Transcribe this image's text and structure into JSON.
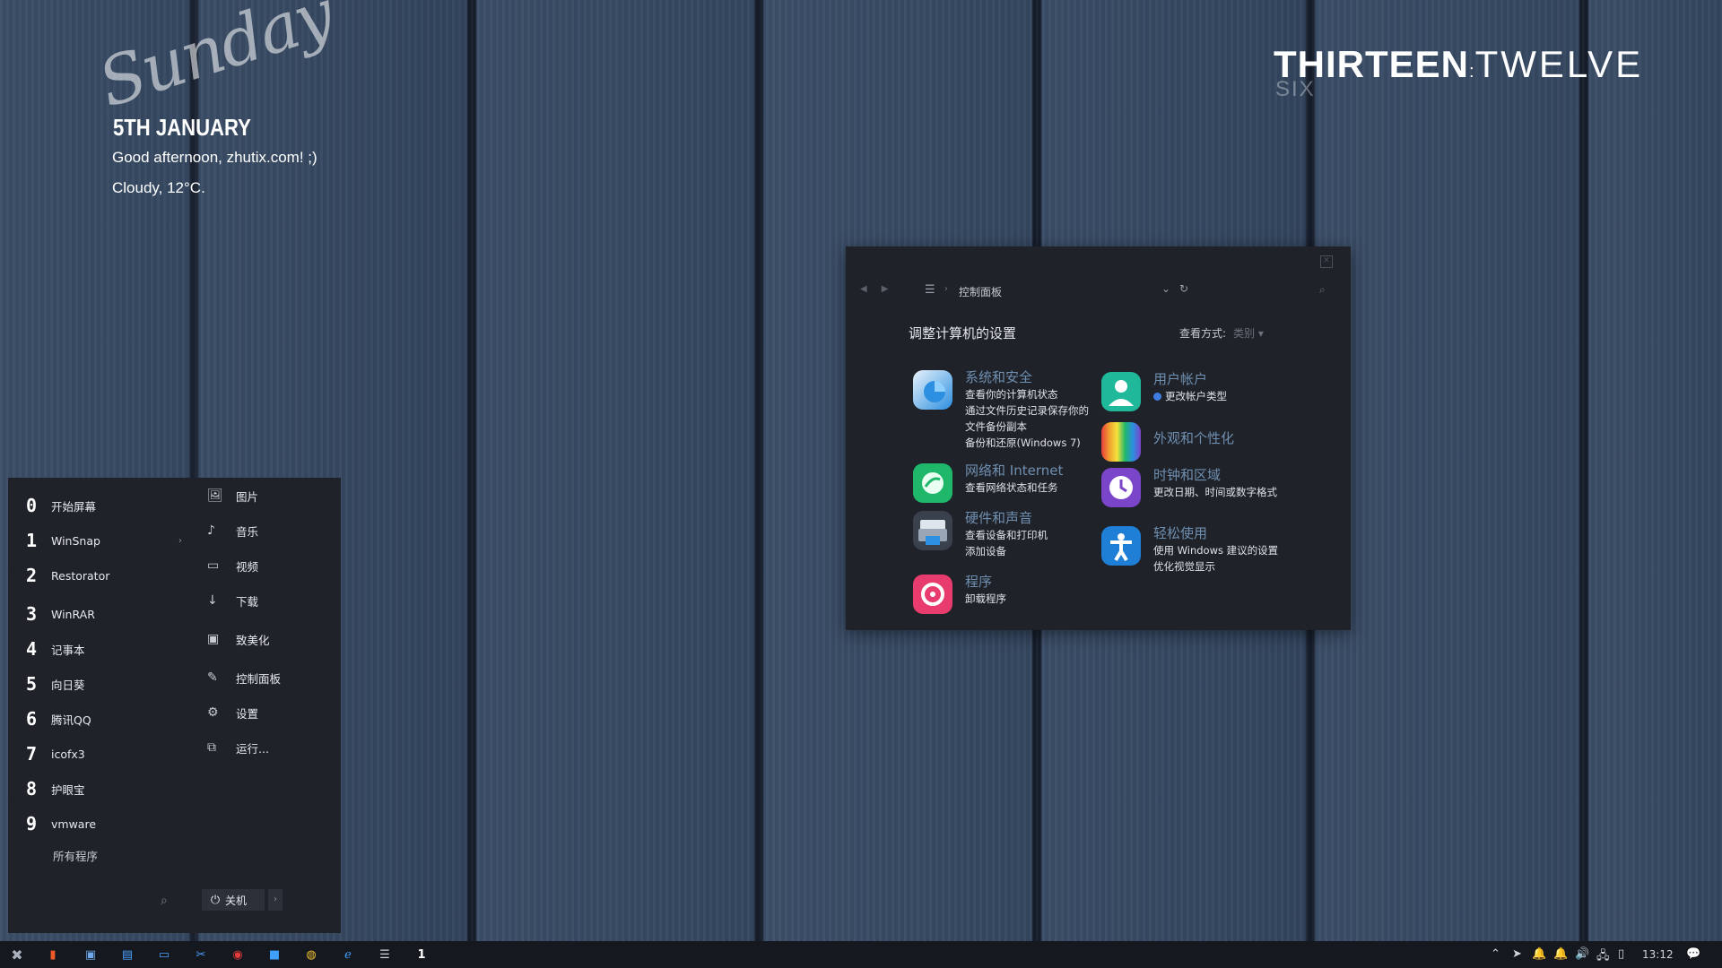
{
  "clock": {
    "day_script": "Sunday",
    "date": "5TH JANUARY",
    "greeting": "Good afternoon, zhutix.com! ;)",
    "weather": "Cloudy, 12°C."
  },
  "brand": {
    "bold": "THIRTEEN",
    "light": "TWELVE",
    "sub": "SIX"
  },
  "control_panel": {
    "breadcrumb": "控制面板",
    "heading": "调整计算机的设置",
    "view_label": "查看方式:",
    "view_value": "类别",
    "categories": [
      {
        "title": "系统和安全",
        "links": [
          "查看你的计算机状态",
          "通过文件历史记录保存你的文件备份副本",
          "备份和还原(Windows 7)"
        ],
        "color": "#2d8fe0"
      },
      {
        "title": "网络和 Internet",
        "links": [
          "查看网络状态和任务"
        ],
        "color": "#1fb86a"
      },
      {
        "title": "硬件和声音",
        "links": [
          "查看设备和打印机",
          "添加设备"
        ],
        "color": "#8a96a6"
      },
      {
        "title": "程序",
        "links": [
          "卸载程序"
        ],
        "color": "#e83b6e"
      },
      {
        "title": "用户帐户",
        "links": [
          "更改帐户类型"
        ],
        "color": "#1fb89a"
      },
      {
        "title": "外观和个性化",
        "links": [],
        "color": "#f0a030"
      },
      {
        "title": "时钟和区域",
        "links": [
          "更改日期、时间或数字格式"
        ],
        "color": "#7b45c9"
      },
      {
        "title": "轻松使用",
        "links": [
          "使用 Windows 建议的设置",
          "优化视觉显示"
        ],
        "color": "#1f7fd6"
      }
    ]
  },
  "start_menu": {
    "apps": [
      {
        "num": "0",
        "name": "开始屏幕"
      },
      {
        "num": "1",
        "name": "WinSnap"
      },
      {
        "num": "2",
        "name": "Restorator"
      },
      {
        "num": "3",
        "name": "WinRAR"
      },
      {
        "num": "4",
        "name": "记事本"
      },
      {
        "num": "5",
        "name": "向日葵"
      },
      {
        "num": "6",
        "name": "腾讯QQ"
      },
      {
        "num": "7",
        "name": "icofx3"
      },
      {
        "num": "8",
        "name": "护眼宝"
      },
      {
        "num": "9",
        "name": "vmware"
      }
    ],
    "all_programs": "所有程序",
    "places": [
      {
        "icon": "image-icon",
        "name": "图片"
      },
      {
        "icon": "music-icon",
        "name": "音乐"
      },
      {
        "icon": "video-icon",
        "name": "视频"
      },
      {
        "icon": "download-icon",
        "name": "下载"
      },
      {
        "icon": "monitor-icon",
        "name": "致美化"
      },
      {
        "icon": "wrench-icon",
        "name": "控制面板"
      },
      {
        "icon": "gear-icon",
        "name": "设置"
      },
      {
        "icon": "run-icon",
        "name": "运行..."
      }
    ],
    "power_label": "关机"
  },
  "taskbar": {
    "time": "13:12"
  }
}
